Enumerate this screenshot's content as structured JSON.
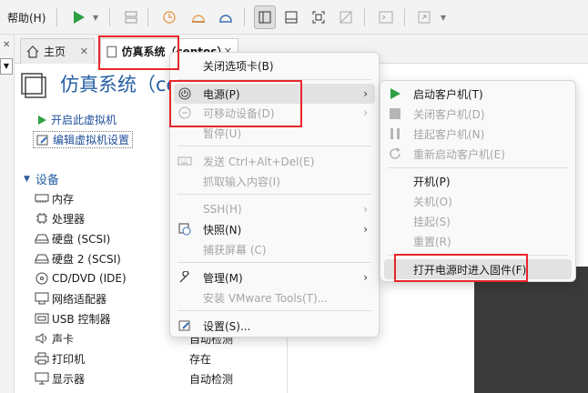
{
  "toolbar": {
    "help_label": "帮助(H)"
  },
  "tabs": [
    {
      "label": "主页"
    },
    {
      "label": "仿真系统（centos）"
    }
  ],
  "vm": {
    "title": "仿真系统（centos）",
    "actions": [
      {
        "label": "开启此虚拟机"
      },
      {
        "label": "编辑虚拟机设置"
      }
    ]
  },
  "devices": {
    "heading": "设备",
    "items": [
      {
        "name": "内存",
        "value": ""
      },
      {
        "name": "处理器",
        "value": ""
      },
      {
        "name": "硬盘 (SCSI)",
        "value": ""
      },
      {
        "name": "硬盘 2 (SCSI)",
        "value": ""
      },
      {
        "name": "CD/DVD (IDE)",
        "value": ""
      },
      {
        "name": "网络适配器",
        "value": ""
      },
      {
        "name": "USB 控制器",
        "value": ""
      },
      {
        "name": "声卡",
        "value": "自动检测"
      },
      {
        "name": "打印机",
        "value": "存在"
      },
      {
        "name": "显示器",
        "value": "自动检测"
      }
    ]
  },
  "context_menu": {
    "items": [
      {
        "label": "关闭选项卡(B)",
        "enabled": true
      },
      {
        "label": "电源(P)",
        "enabled": true,
        "submenu": true,
        "highlighted": true
      },
      {
        "label": "可移动设备(D)",
        "enabled": false,
        "submenu": true
      },
      {
        "label": "暂停(U)",
        "enabled": false
      },
      {
        "label": "发送 Ctrl+Alt+Del(E)",
        "enabled": false
      },
      {
        "label": "抓取输入内容(I)",
        "enabled": false
      },
      {
        "label": "SSH(H)",
        "enabled": false,
        "submenu": true
      },
      {
        "label": "快照(N)",
        "enabled": true,
        "submenu": true
      },
      {
        "label": "捕获屏幕 (C)",
        "enabled": false
      },
      {
        "label": "管理(M)",
        "enabled": true,
        "submenu": true
      },
      {
        "label": "安装 VMware Tools(T)...",
        "enabled": false
      },
      {
        "label": "设置(S)...",
        "enabled": true
      }
    ]
  },
  "power_menu": {
    "items": [
      {
        "label": "启动客户机(T)",
        "enabled": true
      },
      {
        "label": "关闭客户机(D)",
        "enabled": false
      },
      {
        "label": "挂起客户机(N)",
        "enabled": false
      },
      {
        "label": "重新启动客户机(E)",
        "enabled": false
      },
      {
        "label": "开机(P)",
        "enabled": true
      },
      {
        "label": "关机(O)",
        "enabled": false
      },
      {
        "label": "挂起(S)",
        "enabled": false
      },
      {
        "label": "重置(R)",
        "enabled": false
      },
      {
        "label": "打开电源时进入固件(F)",
        "enabled": true,
        "highlighted": true
      }
    ]
  },
  "colors": {
    "accent": "#2660a4",
    "play_green": "#2ea043",
    "annotation_red": "#e8262a"
  }
}
